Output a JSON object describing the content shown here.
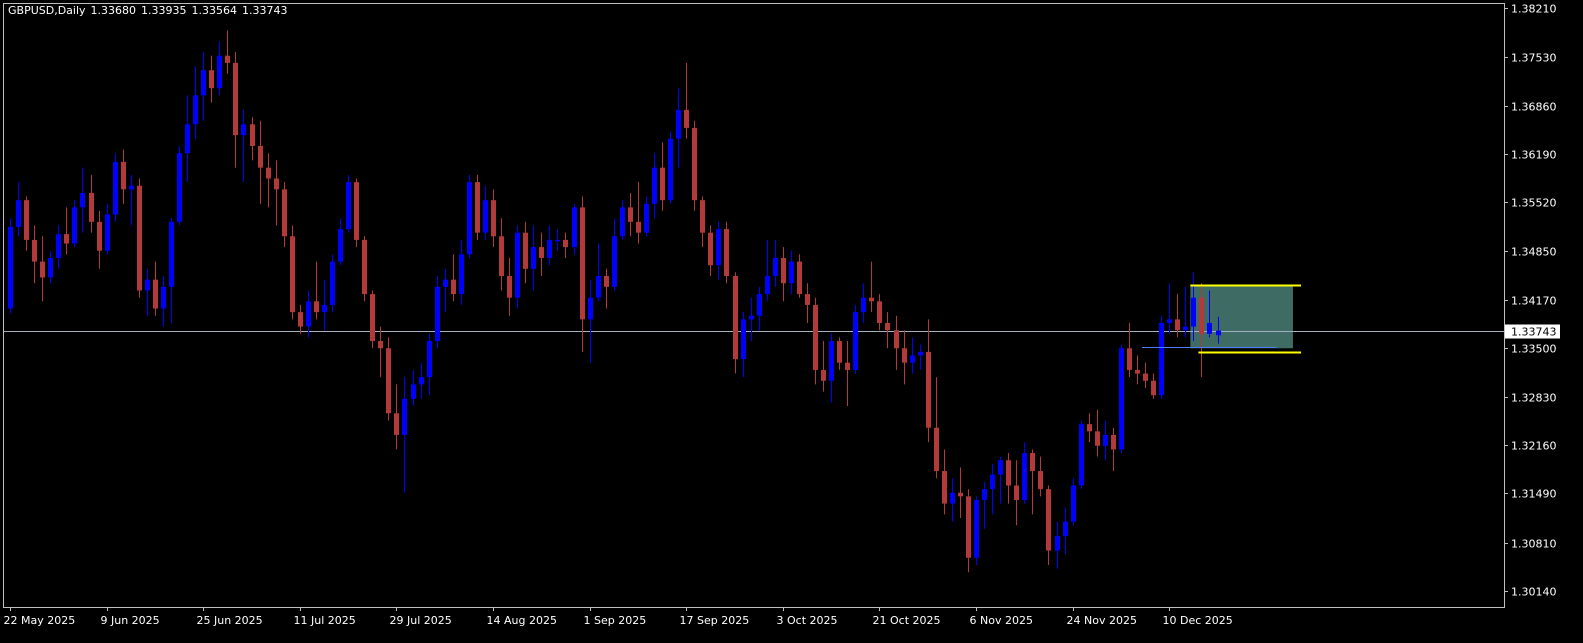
{
  "header": {
    "symbol_timeframe": "GBPUSD,Daily",
    "open": "1.33680",
    "high": "1.33935",
    "low": "1.33564",
    "close": "1.33743"
  },
  "colors": {
    "background": "#000000",
    "frame": "#c0c0c0",
    "text": "#ffffff",
    "bull": "#0000ff",
    "bear": "#b33a3a",
    "price_line": "#a0b0c0",
    "rectangle_fill": "#3e6b64",
    "channel_line": "#ffff00",
    "level_line": "#4f7dff"
  },
  "chart_data": {
    "type": "candlestick",
    "instrument": "GBPUSD",
    "timeframe": "Daily",
    "y_ticks": [
      "1.38210",
      "1.37530",
      "1.36860",
      "1.36190",
      "1.35520",
      "1.34850",
      "1.34170",
      "1.33500",
      "1.32830",
      "1.32160",
      "1.31490",
      "1.30810",
      "1.30140"
    ],
    "y_range": [
      1.2985,
      1.3825
    ],
    "x_ticks": [
      {
        "label": "22 May 2025",
        "bar": 0
      },
      {
        "label": "9 Jun 2025",
        "bar": 12
      },
      {
        "label": "25 Jun 2025",
        "bar": 24
      },
      {
        "label": "11 Jul 2025",
        "bar": 36
      },
      {
        "label": "29 Jul 2025",
        "bar": 48
      },
      {
        "label": "14 Aug 2025",
        "bar": 60
      },
      {
        "label": "1 Sep 2025",
        "bar": 72
      },
      {
        "label": "17 Sep 2025",
        "bar": 84
      },
      {
        "label": "3 Oct 2025",
        "bar": 96
      },
      {
        "label": "21 Oct 2025",
        "bar": 108
      },
      {
        "label": "6 Nov 2025",
        "bar": 120
      },
      {
        "label": "24 Nov 2025",
        "bar": 132
      },
      {
        "label": "10 Dec 2025",
        "bar": 144
      }
    ],
    "current_price": "1.33743",
    "current_price_value": 1.33743,
    "ohlc": [
      [
        1.3405,
        1.353,
        1.3398,
        1.3518
      ],
      [
        1.3518,
        1.358,
        1.3505,
        1.3555
      ],
      [
        1.3555,
        1.356,
        1.3485,
        1.35
      ],
      [
        1.35,
        1.352,
        1.344,
        1.347
      ],
      [
        1.347,
        1.3505,
        1.3415,
        1.3448
      ],
      [
        1.3448,
        1.3485,
        1.344,
        1.3475
      ],
      [
        1.3475,
        1.352,
        1.346,
        1.3508
      ],
      [
        1.3508,
        1.3545,
        1.348,
        1.3495
      ],
      [
        1.3495,
        1.3555,
        1.349,
        1.3545
      ],
      [
        1.3545,
        1.36,
        1.351,
        1.3565
      ],
      [
        1.3565,
        1.359,
        1.351,
        1.3525
      ],
      [
        1.3525,
        1.354,
        1.346,
        1.3485
      ],
      [
        1.3485,
        1.355,
        1.348,
        1.3535
      ],
      [
        1.3535,
        1.362,
        1.3525,
        1.3608
      ],
      [
        1.3608,
        1.3625,
        1.355,
        1.357
      ],
      [
        1.357,
        1.359,
        1.352,
        1.3575
      ],
      [
        1.3575,
        1.3585,
        1.342,
        1.343
      ],
      [
        1.343,
        1.346,
        1.3395,
        1.3445
      ],
      [
        1.3445,
        1.347,
        1.3395,
        1.3405
      ],
      [
        1.3405,
        1.345,
        1.338,
        1.3435
      ],
      [
        1.3435,
        1.353,
        1.3385,
        1.3525
      ],
      [
        1.3525,
        1.363,
        1.352,
        1.362
      ],
      [
        1.362,
        1.37,
        1.358,
        1.366
      ],
      [
        1.366,
        1.374,
        1.364,
        1.37
      ],
      [
        1.37,
        1.376,
        1.3665,
        1.3735
      ],
      [
        1.3735,
        1.3755,
        1.369,
        1.371
      ],
      [
        1.371,
        1.3775,
        1.37,
        1.3755
      ],
      [
        1.3755,
        1.379,
        1.373,
        1.3745
      ],
      [
        1.3745,
        1.376,
        1.36,
        1.3645
      ],
      [
        1.3645,
        1.368,
        1.358,
        1.366
      ],
      [
        1.366,
        1.367,
        1.361,
        1.363
      ],
      [
        1.363,
        1.3665,
        1.355,
        1.36
      ],
      [
        1.36,
        1.362,
        1.3545,
        1.3585
      ],
      [
        1.3585,
        1.361,
        1.352,
        1.357
      ],
      [
        1.357,
        1.358,
        1.349,
        1.3505
      ],
      [
        1.3505,
        1.352,
        1.339,
        1.34
      ],
      [
        1.34,
        1.341,
        1.337,
        1.338
      ],
      [
        1.338,
        1.343,
        1.3365,
        1.3415
      ],
      [
        1.3415,
        1.347,
        1.339,
        1.34
      ],
      [
        1.34,
        1.3445,
        1.3375,
        1.341
      ],
      [
        1.341,
        1.348,
        1.34,
        1.347
      ],
      [
        1.347,
        1.353,
        1.3465,
        1.3515
      ],
      [
        1.3515,
        1.359,
        1.351,
        1.358
      ],
      [
        1.358,
        1.3585,
        1.349,
        1.35
      ],
      [
        1.35,
        1.3505,
        1.3415,
        1.3425
      ],
      [
        1.3425,
        1.343,
        1.335,
        1.336
      ],
      [
        1.336,
        1.338,
        1.331,
        1.335
      ],
      [
        1.335,
        1.3365,
        1.325,
        1.326
      ],
      [
        1.326,
        1.33,
        1.321,
        1.323
      ],
      [
        1.323,
        1.331,
        1.315,
        1.328
      ],
      [
        1.328,
        1.332,
        1.327,
        1.33
      ],
      [
        1.33,
        1.333,
        1.328,
        1.331
      ],
      [
        1.331,
        1.337,
        1.3285,
        1.336
      ],
      [
        1.336,
        1.345,
        1.335,
        1.3435
      ],
      [
        1.3435,
        1.346,
        1.34,
        1.3445
      ],
      [
        1.3445,
        1.348,
        1.3415,
        1.3425
      ],
      [
        1.3425,
        1.35,
        1.341,
        1.348
      ],
      [
        1.348,
        1.359,
        1.3475,
        1.358
      ],
      [
        1.358,
        1.359,
        1.35,
        1.351
      ],
      [
        1.351,
        1.3575,
        1.35,
        1.3555
      ],
      [
        1.3555,
        1.357,
        1.349,
        1.3505
      ],
      [
        1.3505,
        1.353,
        1.343,
        1.345
      ],
      [
        1.345,
        1.3475,
        1.3395,
        1.342
      ],
      [
        1.342,
        1.352,
        1.3405,
        1.351
      ],
      [
        1.351,
        1.3525,
        1.344,
        1.346
      ],
      [
        1.346,
        1.352,
        1.343,
        1.349
      ],
      [
        1.349,
        1.351,
        1.345,
        1.3475
      ],
      [
        1.3475,
        1.352,
        1.3465,
        1.35
      ],
      [
        1.35,
        1.3515,
        1.3485,
        1.35
      ],
      [
        1.35,
        1.351,
        1.3475,
        1.349
      ],
      [
        1.349,
        1.355,
        1.348,
        1.3545
      ],
      [
        1.3545,
        1.356,
        1.3345,
        1.339
      ],
      [
        1.339,
        1.3445,
        1.333,
        1.342
      ],
      [
        1.342,
        1.3495,
        1.3415,
        1.345
      ],
      [
        1.345,
        1.346,
        1.3405,
        1.3435
      ],
      [
        1.3435,
        1.353,
        1.343,
        1.3505
      ],
      [
        1.3505,
        1.3555,
        1.35,
        1.3545
      ],
      [
        1.3545,
        1.3565,
        1.3505,
        1.3525
      ],
      [
        1.3525,
        1.358,
        1.3495,
        1.351
      ],
      [
        1.351,
        1.356,
        1.3505,
        1.355
      ],
      [
        1.355,
        1.362,
        1.353,
        1.36
      ],
      [
        1.36,
        1.3635,
        1.354,
        1.3555
      ],
      [
        1.3555,
        1.365,
        1.355,
        1.364
      ],
      [
        1.364,
        1.371,
        1.36,
        1.368
      ],
      [
        1.368,
        1.3745,
        1.364,
        1.3655
      ],
      [
        1.3655,
        1.3665,
        1.354,
        1.3555
      ],
      [
        1.3555,
        1.356,
        1.349,
        1.351
      ],
      [
        1.351,
        1.352,
        1.345,
        1.3465
      ],
      [
        1.3465,
        1.3525,
        1.3445,
        1.3515
      ],
      [
        1.3515,
        1.3525,
        1.344,
        1.345
      ],
      [
        1.345,
        1.3455,
        1.3315,
        1.3335
      ],
      [
        1.3335,
        1.34,
        1.331,
        1.339
      ],
      [
        1.339,
        1.342,
        1.336,
        1.3395
      ],
      [
        1.3395,
        1.3435,
        1.3375,
        1.3425
      ],
      [
        1.3425,
        1.35,
        1.3415,
        1.345
      ],
      [
        1.345,
        1.35,
        1.3435,
        1.3475
      ],
      [
        1.3475,
        1.349,
        1.3415,
        1.344
      ],
      [
        1.344,
        1.3485,
        1.3425,
        1.347
      ],
      [
        1.347,
        1.348,
        1.342,
        1.3425
      ],
      [
        1.3425,
        1.344,
        1.3385,
        1.341
      ],
      [
        1.341,
        1.342,
        1.33,
        1.332
      ],
      [
        1.332,
        1.336,
        1.329,
        1.3305
      ],
      [
        1.3305,
        1.337,
        1.3275,
        1.336
      ],
      [
        1.336,
        1.3365,
        1.332,
        1.333
      ],
      [
        1.333,
        1.336,
        1.327,
        1.332
      ],
      [
        1.332,
        1.341,
        1.3315,
        1.34
      ],
      [
        1.34,
        1.344,
        1.3385,
        1.342
      ],
      [
        1.342,
        1.347,
        1.34,
        1.3415
      ],
      [
        1.3415,
        1.3425,
        1.3375,
        1.3385
      ],
      [
        1.3385,
        1.34,
        1.335,
        1.3375
      ],
      [
        1.3375,
        1.3395,
        1.332,
        1.335
      ],
      [
        1.335,
        1.3375,
        1.33,
        1.333
      ],
      [
        1.333,
        1.3365,
        1.3315,
        1.334
      ],
      [
        1.334,
        1.3355,
        1.332,
        1.3345
      ],
      [
        1.3345,
        1.339,
        1.322,
        1.324
      ],
      [
        1.324,
        1.331,
        1.317,
        1.318
      ],
      [
        1.318,
        1.321,
        1.312,
        1.3135
      ],
      [
        1.3135,
        1.317,
        1.311,
        1.315
      ],
      [
        1.315,
        1.3185,
        1.3115,
        1.3145
      ],
      [
        1.3145,
        1.3155,
        1.304,
        1.306
      ],
      [
        1.306,
        1.3145,
        1.305,
        1.314
      ],
      [
        1.314,
        1.3165,
        1.31,
        1.3155
      ],
      [
        1.3155,
        1.319,
        1.312,
        1.3175
      ],
      [
        1.3175,
        1.32,
        1.3135,
        1.3195
      ],
      [
        1.3195,
        1.3205,
        1.3135,
        1.316
      ],
      [
        1.316,
        1.3195,
        1.3105,
        1.314
      ],
      [
        1.314,
        1.322,
        1.3135,
        1.3205
      ],
      [
        1.3205,
        1.321,
        1.312,
        1.318
      ],
      [
        1.318,
        1.32,
        1.3145,
        1.3155
      ],
      [
        1.3155,
        1.316,
        1.305,
        1.307
      ],
      [
        1.307,
        1.311,
        1.3045,
        1.309
      ],
      [
        1.309,
        1.313,
        1.3065,
        1.311
      ],
      [
        1.311,
        1.317,
        1.3105,
        1.316
      ],
      [
        1.316,
        1.325,
        1.3155,
        1.3245
      ],
      [
        1.3245,
        1.326,
        1.322,
        1.3235
      ],
      [
        1.3235,
        1.3265,
        1.32,
        1.3215
      ],
      [
        1.3215,
        1.325,
        1.3195,
        1.323
      ],
      [
        1.323,
        1.324,
        1.318,
        1.321
      ],
      [
        1.321,
        1.3355,
        1.3205,
        1.335
      ],
      [
        1.335,
        1.3385,
        1.331,
        1.332
      ],
      [
        1.332,
        1.334,
        1.33,
        1.3315
      ],
      [
        1.3315,
        1.333,
        1.3295,
        1.3305
      ],
      [
        1.3305,
        1.3315,
        1.328,
        1.3285
      ],
      [
        1.3285,
        1.3395,
        1.328,
        1.3385
      ],
      [
        1.3385,
        1.344,
        1.337,
        1.339
      ],
      [
        1.339,
        1.3425,
        1.3365,
        1.3375
      ],
      [
        1.3375,
        1.3435,
        1.3365,
        1.338
      ],
      [
        1.338,
        1.3455,
        1.336,
        1.342
      ],
      [
        1.342,
        1.344,
        1.331,
        1.337
      ],
      [
        1.337,
        1.343,
        1.3365,
        1.3385
      ],
      [
        1.3368,
        1.33935,
        1.33564,
        1.33743
      ]
    ],
    "annotations": [
      {
        "kind": "rectangle",
        "bar_start": 147,
        "bar_end": 159,
        "price_top": 1.3438,
        "price_bottom": 1.335
      },
      {
        "kind": "trendline",
        "color": "yellow",
        "bar_start": 147,
        "bar_end": 160,
        "price": 1.3438
      },
      {
        "kind": "trendline",
        "color": "yellow",
        "bar_start": 148,
        "bar_end": 160,
        "price": 1.3345
      },
      {
        "kind": "level",
        "color": "blue",
        "bar_start": 141,
        "bar_end": 157,
        "price": 1.3352
      }
    ]
  }
}
